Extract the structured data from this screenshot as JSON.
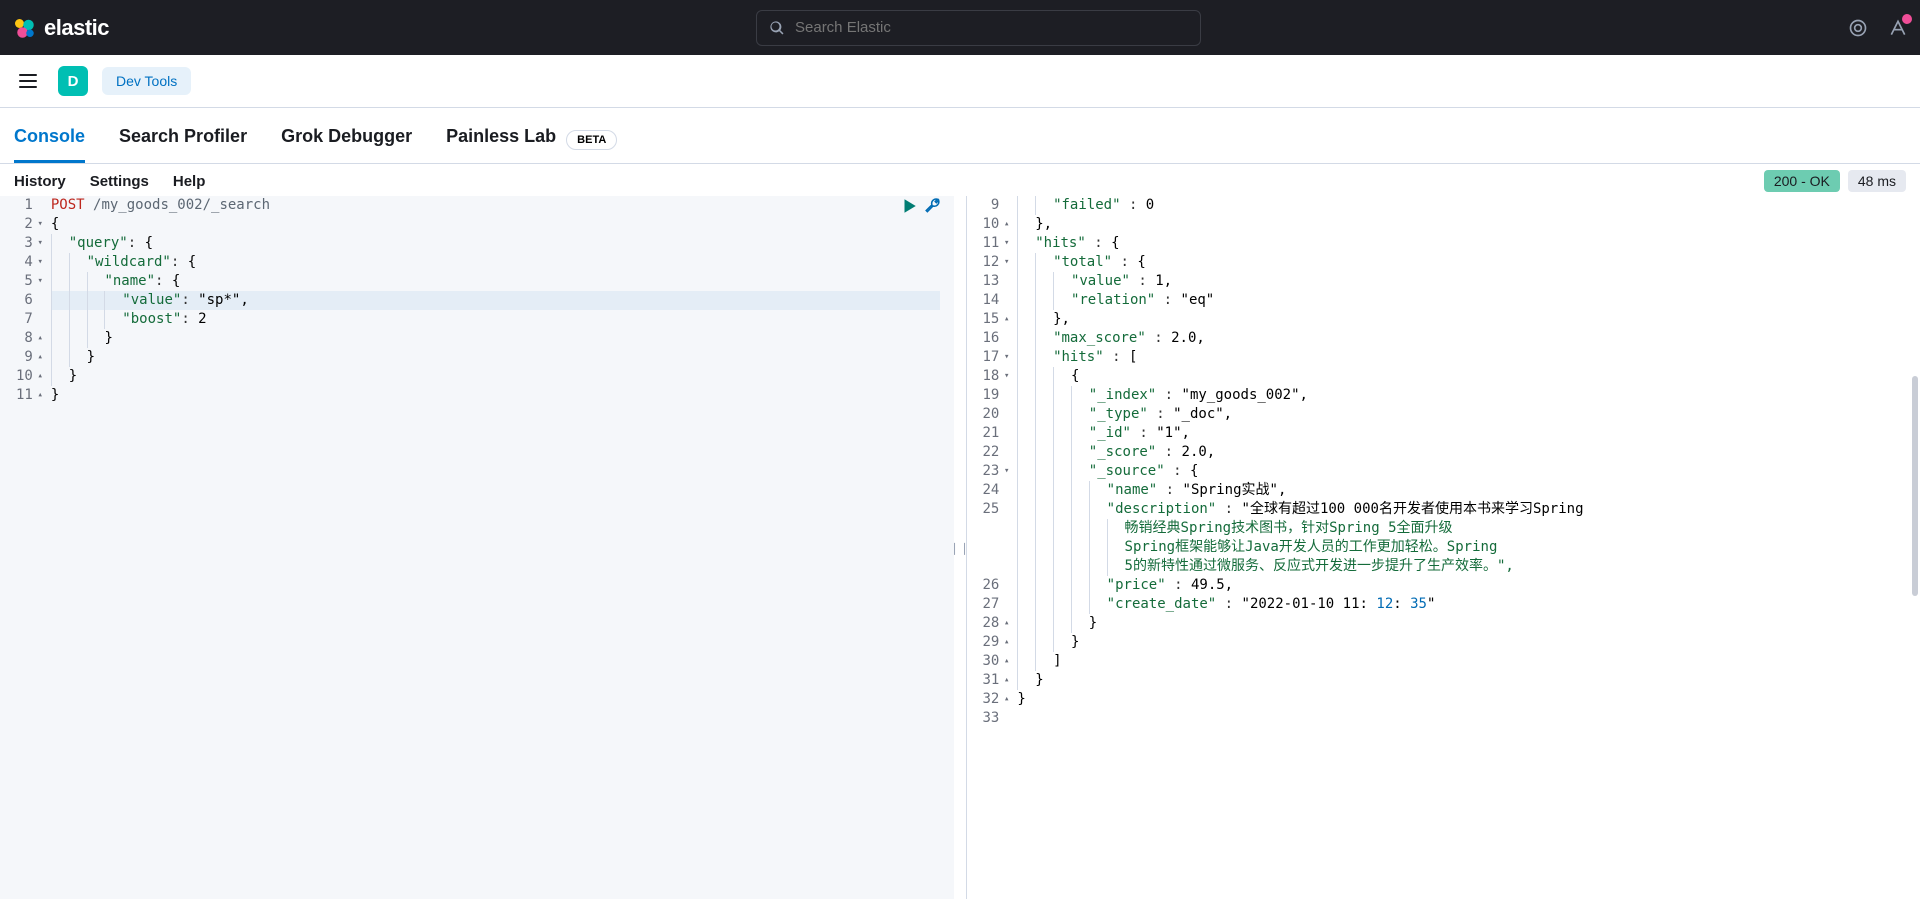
{
  "header": {
    "logo_text": "elastic",
    "search_placeholder": "Search Elastic"
  },
  "subheader": {
    "space_letter": "D",
    "breadcrumb": "Dev Tools"
  },
  "tabs": [
    {
      "label": "Console",
      "active": true
    },
    {
      "label": "Search Profiler",
      "active": false
    },
    {
      "label": "Grok Debugger",
      "active": false
    },
    {
      "label": "Painless Lab",
      "active": false
    }
  ],
  "beta_label": "BETA",
  "toolbar": {
    "links": [
      "History",
      "Settings",
      "Help"
    ],
    "status": "200 - OK",
    "time": "48 ms"
  },
  "request": {
    "method": "POST",
    "path": "/my_goods_002/_search",
    "body_lines": [
      {
        "n": 1,
        "fold": "",
        "raw": "method_path"
      },
      {
        "n": 2,
        "fold": "▾",
        "txt": "{"
      },
      {
        "n": 3,
        "fold": "▾",
        "txt": "  \"query\": {"
      },
      {
        "n": 4,
        "fold": "▾",
        "txt": "    \"wildcard\": {"
      },
      {
        "n": 5,
        "fold": "▾",
        "txt": "      \"name\": {"
      },
      {
        "n": 6,
        "fold": "",
        "txt": "        \"value\": \"sp*\",",
        "hl": true
      },
      {
        "n": 7,
        "fold": "",
        "txt": "        \"boost\": 2"
      },
      {
        "n": 8,
        "fold": "▴",
        "txt": "      }"
      },
      {
        "n": 9,
        "fold": "▴",
        "txt": "    }"
      },
      {
        "n": 10,
        "fold": "▴",
        "txt": "  }"
      },
      {
        "n": 11,
        "fold": "▴",
        "txt": "}"
      }
    ]
  },
  "response_lines": [
    {
      "n": 9,
      "fold": "",
      "txt": "    \"failed\" : 0"
    },
    {
      "n": 10,
      "fold": "▴",
      "txt": "  },"
    },
    {
      "n": 11,
      "fold": "▾",
      "txt": "  \"hits\" : {"
    },
    {
      "n": 12,
      "fold": "▾",
      "txt": "    \"total\" : {"
    },
    {
      "n": 13,
      "fold": "",
      "txt": "      \"value\" : 1,"
    },
    {
      "n": 14,
      "fold": "",
      "txt": "      \"relation\" : \"eq\""
    },
    {
      "n": 15,
      "fold": "▴",
      "txt": "    },"
    },
    {
      "n": 16,
      "fold": "",
      "txt": "    \"max_score\" : 2.0,"
    },
    {
      "n": 17,
      "fold": "▾",
      "txt": "    \"hits\" : ["
    },
    {
      "n": 18,
      "fold": "▾",
      "txt": "      {"
    },
    {
      "n": 19,
      "fold": "",
      "txt": "        \"_index\" : \"my_goods_002\","
    },
    {
      "n": 20,
      "fold": "",
      "txt": "        \"_type\" : \"_doc\","
    },
    {
      "n": 21,
      "fold": "",
      "txt": "        \"_id\" : \"1\","
    },
    {
      "n": 22,
      "fold": "",
      "txt": "        \"_score\" : 2.0,"
    },
    {
      "n": 23,
      "fold": "▾",
      "txt": "        \"_source\" : {"
    },
    {
      "n": 24,
      "fold": "",
      "txt": "          \"name\" : \"Spring实战\","
    },
    {
      "n": 25,
      "fold": "",
      "txt": "          \"description\" : \"全球有超过100 000名开发者使用本书来学习Spring"
    },
    {
      "n": "",
      "fold": "",
      "txt": "            畅销经典Spring技术图书，针对Spring 5全面升级"
    },
    {
      "n": "",
      "fold": "",
      "txt": "            Spring框架能够让Java开发人员的工作更加轻松。Spring"
    },
    {
      "n": "",
      "fold": "",
      "txt": "            5的新特性通过微服务、反应式开发进一步提升了生产效率。\","
    },
    {
      "n": 26,
      "fold": "",
      "txt": "          \"price\" : 49.5,"
    },
    {
      "n": 27,
      "fold": "",
      "txt": "          \"create_date\" : \"2022-01-10 11:12:35\""
    },
    {
      "n": 28,
      "fold": "▴",
      "txt": "        }"
    },
    {
      "n": 29,
      "fold": "▴",
      "txt": "      }"
    },
    {
      "n": 30,
      "fold": "▴",
      "txt": "    ]"
    },
    {
      "n": 31,
      "fold": "▴",
      "txt": "  }"
    },
    {
      "n": 32,
      "fold": "▴",
      "txt": "}"
    },
    {
      "n": 33,
      "fold": "",
      "txt": ""
    }
  ]
}
